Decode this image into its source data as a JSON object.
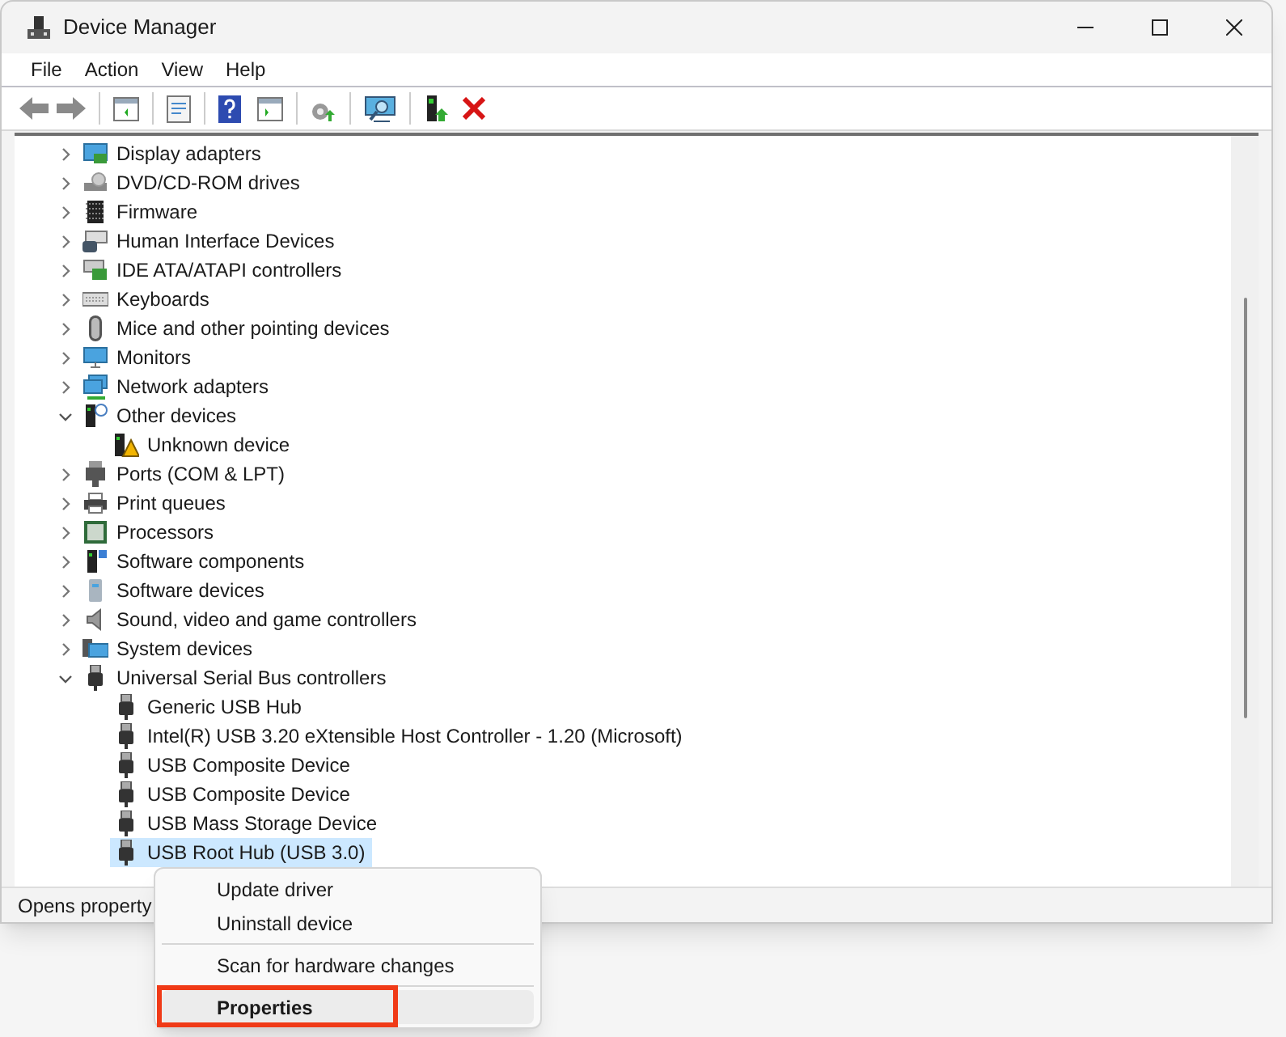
{
  "window": {
    "title": "Device Manager"
  },
  "menu_bar": [
    "File",
    "Action",
    "View",
    "Help"
  ],
  "tree": [
    {
      "label": "Display adapters",
      "expanded": false
    },
    {
      "label": "DVD/CD-ROM drives",
      "expanded": false
    },
    {
      "label": "Firmware",
      "expanded": false
    },
    {
      "label": "Human Interface Devices",
      "expanded": false
    },
    {
      "label": "IDE ATA/ATAPI controllers",
      "expanded": false
    },
    {
      "label": "Keyboards",
      "expanded": false
    },
    {
      "label": "Mice and other pointing devices",
      "expanded": false
    },
    {
      "label": "Monitors",
      "expanded": false
    },
    {
      "label": "Network adapters",
      "expanded": false
    },
    {
      "label": "Other devices",
      "expanded": true,
      "children": [
        {
          "label": "Unknown device",
          "selected": false
        }
      ]
    },
    {
      "label": "Ports (COM & LPT)",
      "expanded": false
    },
    {
      "label": "Print queues",
      "expanded": false
    },
    {
      "label": "Processors",
      "expanded": false
    },
    {
      "label": "Software components",
      "expanded": false
    },
    {
      "label": "Software devices",
      "expanded": false
    },
    {
      "label": "Sound, video and game controllers",
      "expanded": false
    },
    {
      "label": "System devices",
      "expanded": false
    },
    {
      "label": "Universal Serial Bus controllers",
      "expanded": true,
      "children": [
        {
          "label": "Generic USB Hub",
          "selected": false
        },
        {
          "label": "Intel(R) USB 3.20 eXtensible Host Controller - 1.20 (Microsoft)",
          "selected": false
        },
        {
          "label": "USB Composite Device",
          "selected": false
        },
        {
          "label": "USB Composite Device",
          "selected": false
        },
        {
          "label": "USB Mass Storage Device",
          "selected": false
        },
        {
          "label": "USB Root Hub (USB 3.0)",
          "selected": true
        }
      ]
    }
  ],
  "status_bar": "Opens property",
  "context_menu": [
    {
      "kind": "item",
      "label": "Update driver",
      "bold": false,
      "hovered": false,
      "outlined": false
    },
    {
      "kind": "item",
      "label": "Uninstall device",
      "bold": false,
      "hovered": false,
      "outlined": false
    },
    {
      "kind": "separator"
    },
    {
      "kind": "item",
      "label": "Scan for hardware changes",
      "bold": false,
      "hovered": false,
      "outlined": false
    },
    {
      "kind": "separator"
    },
    {
      "kind": "item",
      "label": "Properties",
      "bold": true,
      "hovered": true,
      "outlined": true
    }
  ]
}
